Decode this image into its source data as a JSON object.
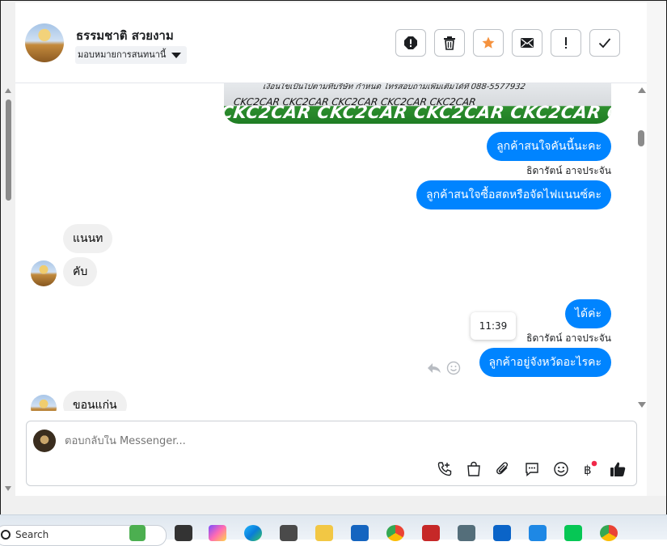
{
  "header": {
    "name": "ธรรมชาติ สวยงาม",
    "assign_label": "มอบหมายการสนทนานี้",
    "actions": [
      "spam-icon",
      "trash-icon",
      "star-icon",
      "mail-icon",
      "exclamation-icon",
      "check-icon"
    ],
    "colors": {
      "star": "#f5923e"
    }
  },
  "chat": {
    "image_caption_line1": "เงื่อนไขเป็นไปตามที่บริษัท กำหนด โทรสอบถามเพิ่มเติมได้ที่ 088-5577932",
    "image_caption_line2": "CKC2CAR CKC2CAR CKC2CAR CKC2CAR CKC2CAR",
    "image_banner": "CKC2CAR CKC2CAR CKC2CAR CKC2CAR CKC2",
    "messages": [
      {
        "dir": "out",
        "text": "ลูกค้าสนใจคันนี้นะคะ"
      },
      {
        "dir": "sender",
        "text": "ธิดารัตน์ อาจประจัน"
      },
      {
        "dir": "out",
        "text": "ลูกค้าสนใจซื้อสดหรือจัดไฟแนนซ์คะ"
      },
      {
        "dir": "in",
        "text": "แนนท"
      },
      {
        "dir": "in",
        "text": "คับ"
      },
      {
        "dir": "out",
        "text": "ได้ค่ะ"
      },
      {
        "dir": "sender",
        "text": "ธิดารัตน์ อาจประจัน"
      },
      {
        "dir": "out",
        "text": "ลูกค้าอยู่จังหวัดอะไรคะ"
      },
      {
        "dir": "in",
        "text": "ขอนแก่น"
      }
    ],
    "tooltip_time": "11:39",
    "colors": {
      "outgoing": "#0084ff",
      "incoming": "#f0f0f0"
    }
  },
  "composer": {
    "placeholder": "ตอบกลับใน Messenger...",
    "icons": [
      "call-icon",
      "shop-icon",
      "attachment-icon",
      "saved-reply-icon",
      "emoji-icon",
      "baht-icon",
      "like-icon"
    ]
  },
  "taskbar": {
    "search_text": "Search"
  }
}
